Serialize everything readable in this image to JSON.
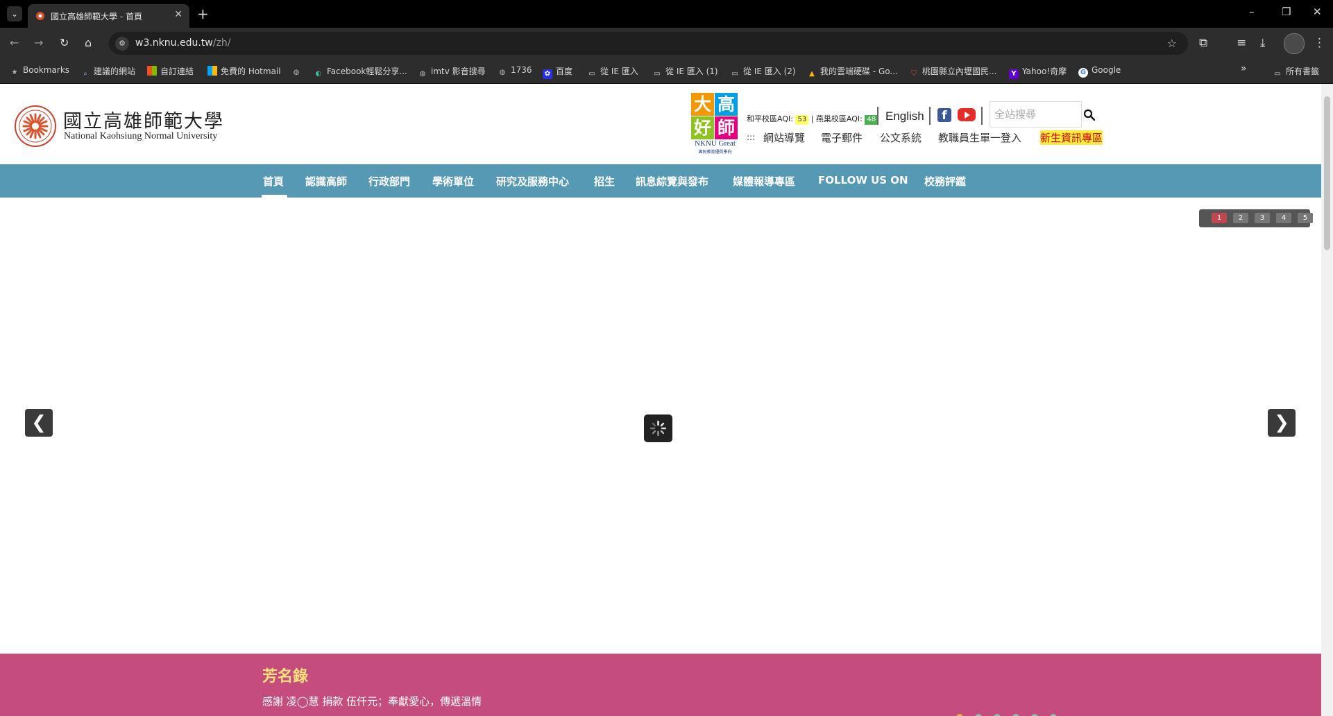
{
  "browser": {
    "tab_title": "國立高雄師範大學 - 首頁",
    "url_host": "w3.nknu.edu.tw",
    "url_path": "/zh/",
    "bookmarks": [
      {
        "label": "Bookmarks",
        "icon": "star-icon"
      },
      {
        "label": "建議的網站",
        "icon": "search-icon"
      },
      {
        "label": "自訂連結",
        "icon": "windows-icon"
      },
      {
        "label": "免費的 Hotmail",
        "icon": "windows-icon"
      },
      {
        "label": "",
        "icon": "globe-icon"
      },
      {
        "label": "Facebook輕鬆分享...",
        "icon": "edge-icon"
      },
      {
        "label": "imtv 影音搜尋",
        "icon": "globe-icon"
      },
      {
        "label": "1736",
        "icon": "globe-icon"
      },
      {
        "label": "百度",
        "icon": "baidu-icon"
      },
      {
        "label": "從 IE 匯入",
        "icon": "folder-icon"
      },
      {
        "label": "從 IE 匯入 (1)",
        "icon": "folder-icon"
      },
      {
        "label": "從 IE 匯入 (2)",
        "icon": "folder-icon"
      },
      {
        "label": "我的雲端硬碟 - Go...",
        "icon": "drive-icon"
      },
      {
        "label": "桃園縣立內壢國民...",
        "icon": "shield-icon"
      },
      {
        "label": "Yahoo!奇摩",
        "icon": "yahoo-icon"
      },
      {
        "label": "Google",
        "icon": "google-icon"
      }
    ],
    "all_bookmarks": "所有書籤"
  },
  "header": {
    "logo_zh": "國立高雄師範大學",
    "logo_en": "National Kaohsiung Normal University",
    "great_chars": [
      "大",
      "高",
      "好",
      "師"
    ],
    "great_caption": "NKNU Great",
    "great_sub": "國民教育優質學府",
    "aqi": {
      "heping_label": "和平校區AQI:",
      "heping_value": "53",
      "divider": "|",
      "yanchao_label": "燕巢校區AQI:",
      "yanchao_value": "48"
    },
    "english_link": "English",
    "search_placeholder": "全站搜尋",
    "util_prefix": ":::",
    "util_links": [
      "網站導覽",
      "電子郵件",
      "公文系統",
      "教職員生單一登入"
    ],
    "highlight_link": "新生資訊專區",
    "colors": {
      "aqi_moderate": "#ffff66",
      "aqi_good": "#4caf50",
      "nav": "#5699b5",
      "honor_bg": "#c54d7e",
      "honor_title": "#ffe27a"
    }
  },
  "nav": {
    "items": [
      "首頁",
      "認識高師",
      "行政部門",
      "學術單位",
      "研究及服務中心",
      "招生",
      "訊息綜覽與發布",
      "媒體報導專區",
      "FOLLOW US ON",
      "校務評鑑"
    ],
    "active_index": 0
  },
  "slider": {
    "pages": [
      "1",
      "2",
      "3",
      "4",
      "5"
    ],
    "active_page": "1",
    "prev": "❮",
    "next": "❯"
  },
  "honor": {
    "title": "芳名錄",
    "text": "感謝 凌◯慧 捐款 伍仟元；奉獻愛心，傳遞溫情"
  }
}
